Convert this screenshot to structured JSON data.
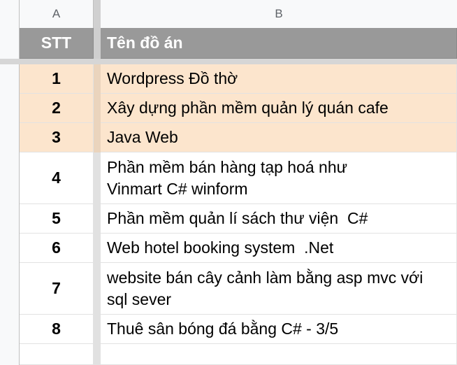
{
  "column_headers": {
    "a": "A",
    "b": "B"
  },
  "header": {
    "stt": "STT",
    "name": "Tên đồ án"
  },
  "rows": [
    {
      "stt": "1",
      "name": "Wordpress Đồ thờ"
    },
    {
      "stt": "2",
      "name": "Xây dựng phần mềm quản lý quán cafe"
    },
    {
      "stt": "3",
      "name": "Java Web"
    },
    {
      "stt": "4",
      "name": "Phần mềm bán hàng tạp hoá như Vinmart C# winform"
    },
    {
      "stt": "5",
      "name": "Phần mềm quản lí sách thư viện  C#"
    },
    {
      "stt": "6",
      "name": "Web hotel booking system  .Net"
    },
    {
      "stt": "7",
      "name": "website bán cây cảnh làm bằng asp mvc với sql sever"
    },
    {
      "stt": "8",
      "name": "Thuê sân bóng đá bằng C# - 3/5"
    }
  ],
  "colors": {
    "header_bg": "#999999",
    "highlight_bg": "#fce5cd",
    "grid": "#e2e2e2"
  }
}
